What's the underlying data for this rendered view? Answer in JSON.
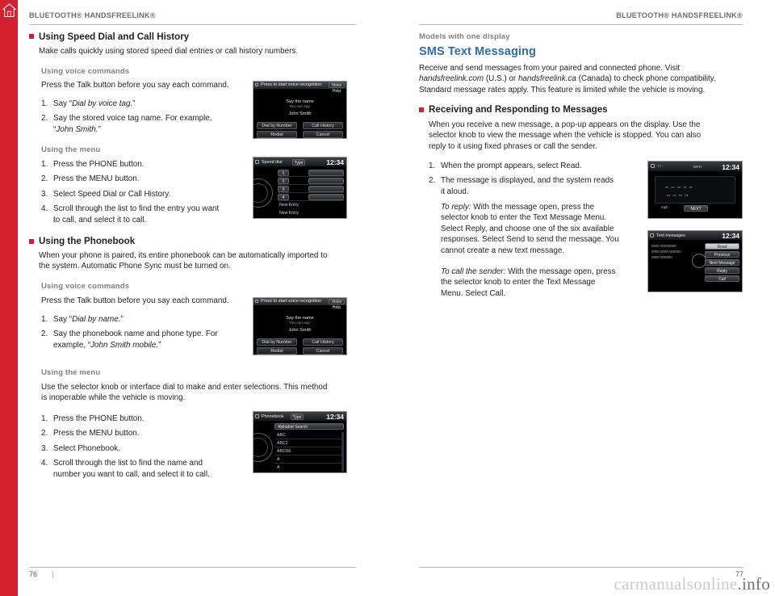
{
  "red_bar": {
    "icon": "home-icon"
  },
  "left_page": {
    "header": {
      "text": "BLUETOOTH® HANDSFREELINK®"
    },
    "section1": {
      "title": "Using Speed Dial and Call History",
      "intro": "Make calls quickly using stored speed dial entries or call history numbers.",
      "voice_label": "Using voice commands",
      "voice_intro": "Press the Talk button before you say each command.",
      "voice_steps": [
        {
          "n": "1.",
          "pre": "Say “",
          "ital": "Dial by voice tag.",
          "post": "”"
        },
        {
          "n": "2.",
          "pre": "Say the stored voice tag name. For example,",
          "ital": "",
          "post": ""
        }
      ],
      "voice_step2_line2_pre": "“",
      "voice_step2_line2_ital": "John Smith.",
      "voice_step2_line2_post": "”",
      "menu_label": "Using the menu",
      "menu_steps": [
        "Press the PHONE button.",
        "Press the MENU button.",
        "Select Speed Dial or Call History.",
        "Scroll through the list to find the entry you want"
      ],
      "menu_step4_line2": "to call, and select it to call."
    },
    "section2": {
      "title": "Using the Phonebook",
      "intro_line1": "When your phone is paired, its entire phonebook can be automatically imported to",
      "intro_line2": "the system. Automatic Phone Sync must be turned on.",
      "voice_label": "Using voice commands",
      "voice_intro": "Press the Talk button before you say each command.",
      "voice_step1_pre": "Say “",
      "voice_step1_ital": "Dial by name.",
      "voice_step1_post": "”",
      "voice_step2_line1": "Say the phonebook name and phone type. For",
      "voice_step2_line2_pre": "example, “",
      "voice_step2_line2_ital": "John Smith mobile.",
      "voice_step2_line2_post": "”",
      "menu_label": "Using the menu",
      "menu_intro_line1": "Use the selector knob or interface dial to make and enter selections. This method",
      "menu_intro_line2": "is inoperable while the vehicle is moving.",
      "menu_steps": [
        "Press the PHONE button.",
        "Press the MENU button.",
        "Select Phonebook.",
        "Scroll through the list to find the name and"
      ],
      "menu_step4_line2": "number you want to call, and select it to call."
    },
    "footer": {
      "page": "76"
    }
  },
  "right_page": {
    "header": {
      "text": "BLUETOOTH® HANDSFREELINK®"
    },
    "models_label": "Models with one display",
    "title": "SMS Text Messaging",
    "intro_line1": "Receive and send messages from your paired and connected phone. Visit",
    "intro_line2_ital1": "handsfreelink.com",
    "intro_line2_mid": " (U.S.) or ",
    "intro_line2_ital2": "handsfreelink.ca",
    "intro_line2_end": " (Canada) to check phone compatibility.",
    "intro_line3": "Standard message rates apply. This feature is limited while the vehicle is moving.",
    "section": {
      "title": "Receiving and Responding to Messages",
      "p_line1": "When you receive a new message, a pop-up appears on the display. Use the",
      "p_line2": "selector knob to view the message when the vehicle is stopped. You can also",
      "p_line3": "reply to it using fixed phrases or call the sender.",
      "steps": [
        "When the prompt appears, select Read.",
        "The message is displayed, and the system reads"
      ],
      "step2_line2": "it aloud.",
      "reply_ital": "To reply:",
      "reply_lines": [
        " With the message open, press the",
        "selector knob to enter the Text Message Menu.",
        "Select Reply, and choose one of the six available",
        "responses. Select Send to send the message. You",
        "cannot create a new text message."
      ],
      "call_ital": "To call the sender:",
      "call_lines": [
        " With the message open, press",
        "the selector knob to enter the Text Message",
        "Menu. Select Call."
      ]
    },
    "footer": {
      "page": "77"
    }
  },
  "screens": {
    "speed_voice": {
      "top_left": "Press  to start voice recognition",
      "top_right": "Voice Help",
      "line1": "Say the name",
      "line2": "You can say:",
      "line3": "John Smith",
      "btn1": "Dial by Number",
      "btn2": "Call History",
      "btn3": "Redial",
      "btn4": "Cancel"
    },
    "speed_menu": {
      "title": "Speed dial",
      "type_btn": "Type",
      "clock": "12:34",
      "rows_left": [
        "",
        "",
        "",
        "",
        "New Entry",
        "New Entry"
      ],
      "rows_right": [
        "",
        "",
        "",
        "",
        "",
        ""
      ]
    },
    "phone_voice": {
      "top_left": "Press  to start voice recognition",
      "top_right": "Voice Help",
      "line1": "Say the name",
      "line2": "You can say:",
      "line3": "John Smith",
      "btn1": "Dial by Number",
      "btn2": "Call History",
      "btn3": "Redial",
      "btn4": "Cancel"
    },
    "phonebook_menu": {
      "title": "Phonebook",
      "type_btn": "Type",
      "clock": "12:34",
      "search_row": "Alphabet Search",
      "rows": [
        "ABC",
        "ABC2",
        "ABCDE",
        "A",
        "A"
      ]
    },
    "meter_display": {
      "clock": "12:34",
      "unit": "MPH"
    },
    "text_menu": {
      "title": "Text messages",
      "clock": "12:34",
      "items": [
        "Read",
        "Previous Message",
        "Next Message",
        "Reply",
        "Call"
      ]
    }
  },
  "watermark": {
    "light": "carmanualsonline",
    "dark": ".info"
  }
}
